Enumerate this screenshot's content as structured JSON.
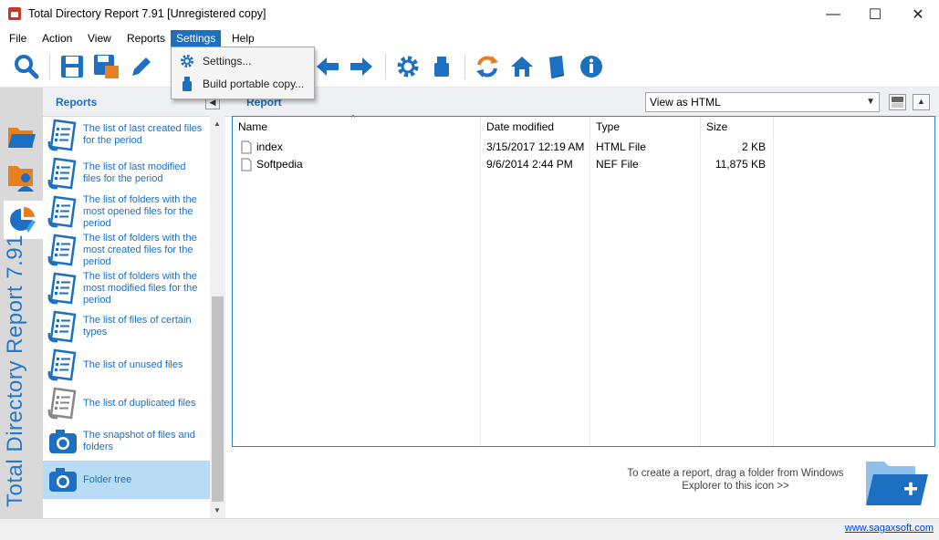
{
  "window": {
    "title": "Total Directory Report 7.91 [Unregistered copy]",
    "minimize": "—",
    "maximize": "☐",
    "close": "✕"
  },
  "menu": {
    "items": [
      "File",
      "Action",
      "View",
      "Reports",
      "Settings",
      "Help"
    ],
    "active": "Settings"
  },
  "settings_menu": {
    "items": [
      {
        "label": "Settings...",
        "icon": "gear-icon"
      },
      {
        "label": "Build portable copy...",
        "icon": "usb-drive-icon"
      }
    ]
  },
  "toolbar": {
    "icons": [
      "search-icon",
      "save-icon",
      "save-as-icon",
      "edit-icon",
      "back-arrow-icon",
      "forward-arrow-icon",
      "gear-icon",
      "usb-drive-icon",
      "refresh-icon",
      "home-icon",
      "book-icon",
      "info-icon"
    ]
  },
  "sidebar": {
    "vertical_title": "Total Directory Report  7.91",
    "tabs": [
      "folder-icon",
      "folder-user-icon",
      "chart-report-icon"
    ]
  },
  "reports_panel": {
    "title": "Reports",
    "items": [
      {
        "label": "The list of last created files for the period",
        "icon": "report-list-icon"
      },
      {
        "label": "The list of last modified files for the period",
        "icon": "report-list-icon"
      },
      {
        "label": "The list of folders with the most opened files for the period",
        "icon": "report-list-icon"
      },
      {
        "label": "The list of folders with the most created files for the period",
        "icon": "report-list-icon"
      },
      {
        "label": "The list of folders with the most modified files for the period",
        "icon": "report-list-icon"
      },
      {
        "label": "The list of files of certain types",
        "icon": "report-list-icon"
      },
      {
        "label": "The list of unused files",
        "icon": "report-list-icon"
      },
      {
        "label": "The list of duplicated files",
        "icon": "report-list-gray-icon"
      },
      {
        "label": "The snapshot of files and folders",
        "icon": "camera-icon"
      },
      {
        "label": "Folder tree",
        "icon": "camera-icon"
      }
    ],
    "selected": "Folder tree"
  },
  "report_area": {
    "title": "Report",
    "view_select": "View as HTML",
    "columns": [
      "Name",
      "Date modified",
      "Type",
      "Size"
    ],
    "rows": [
      {
        "name": "index",
        "date": "3/15/2017 12:19 AM",
        "type": "HTML File",
        "size": "2 KB"
      },
      {
        "name": "Softpedia",
        "date": "9/6/2014 2:44 PM",
        "type": "NEF File",
        "size": "11,875 KB"
      }
    ],
    "hint": "To create a report, drag a folder from Windows Explorer to this icon >>"
  },
  "statusbar": {
    "link": "www.sagaxsoft.com"
  },
  "colors": {
    "accent": "#1d6fc1",
    "selected": "#b8dcf3"
  }
}
